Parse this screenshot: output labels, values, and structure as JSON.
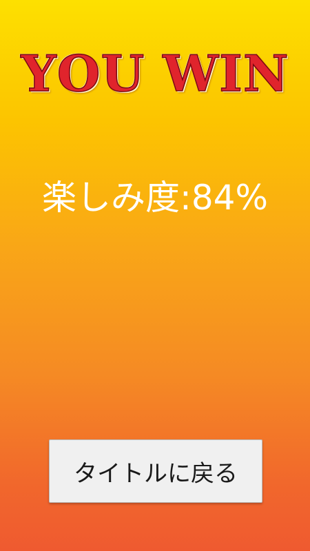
{
  "result": {
    "title": "YOU WIN"
  },
  "score": {
    "label": "楽しみ度",
    "separator": ":",
    "value": "84%"
  },
  "actions": {
    "back_to_title_label": "タイトルに戻る"
  },
  "colors": {
    "background_top": "#fde000",
    "background_bottom": "#ef5a30",
    "title_fill": "#e0242c",
    "score_text": "#ffffff",
    "button_bg": "#f0f0f0"
  }
}
